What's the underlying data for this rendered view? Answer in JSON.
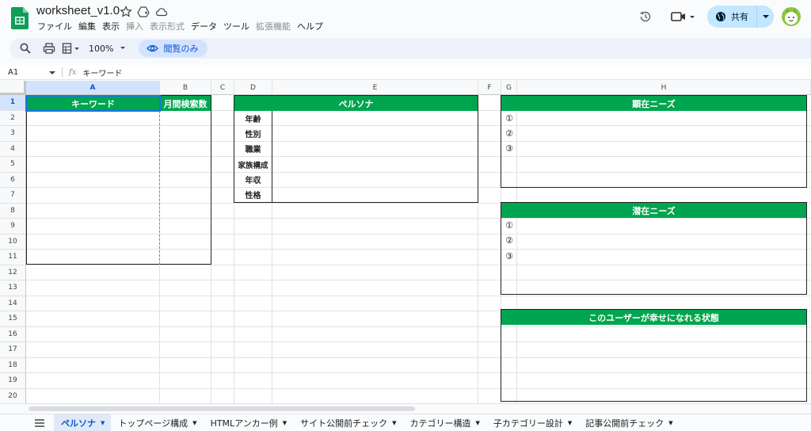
{
  "app": {
    "title": "worksheet_v1.0",
    "menu": [
      "ファイル",
      "編集",
      "表示",
      "挿入",
      "表示形式",
      "データ",
      "ツール",
      "拡張機能",
      "ヘルプ"
    ],
    "menu_disabled": [
      false,
      false,
      false,
      true,
      true,
      false,
      false,
      true,
      false
    ],
    "share_label": "共有"
  },
  "toolbar": {
    "zoom": "100%",
    "view_only_label": "閲覧のみ"
  },
  "formula_bar": {
    "cell_ref": "A1",
    "fx_label": "fx",
    "value": "キーワード"
  },
  "grid": {
    "columns": [
      "A",
      "B",
      "C",
      "D",
      "E",
      "F",
      "G",
      "H"
    ],
    "rows": [
      "1",
      "2",
      "3",
      "4",
      "5",
      "6",
      "7",
      "8",
      "9",
      "10",
      "11",
      "12",
      "13",
      "14",
      "15",
      "16",
      "17",
      "18",
      "19",
      "20"
    ],
    "selected_column": "A",
    "selected_row": "1"
  },
  "sheet": {
    "keyword_header": "キーワード",
    "search_volume_header": "月間検索数",
    "persona_header": "ペルソナ",
    "persona_fields": [
      "年齢",
      "性別",
      "職業",
      "家族構成",
      "年収",
      "性格"
    ],
    "explicit_needs_header": "顕在ニーズ",
    "latent_needs_header": "潜在ニーズ",
    "happy_state_header": "このユーザーが幸せになれる状態",
    "needs_markers": [
      "①",
      "②",
      "③"
    ]
  },
  "tabs": [
    {
      "label": "ペルソナ",
      "active": true
    },
    {
      "label": "トップページ構成",
      "active": false
    },
    {
      "label": "HTMLアンカー例",
      "active": false
    },
    {
      "label": "サイト公開前チェック",
      "active": false
    },
    {
      "label": "カテゴリー構造",
      "active": false
    },
    {
      "label": "子カテゴリー設計",
      "active": false
    },
    {
      "label": "記事公開前チェック",
      "active": false
    }
  ],
  "colors": {
    "header_green": "#00a54f",
    "accent_blue": "#0b57d0",
    "share_bg": "#c2e7ff"
  }
}
